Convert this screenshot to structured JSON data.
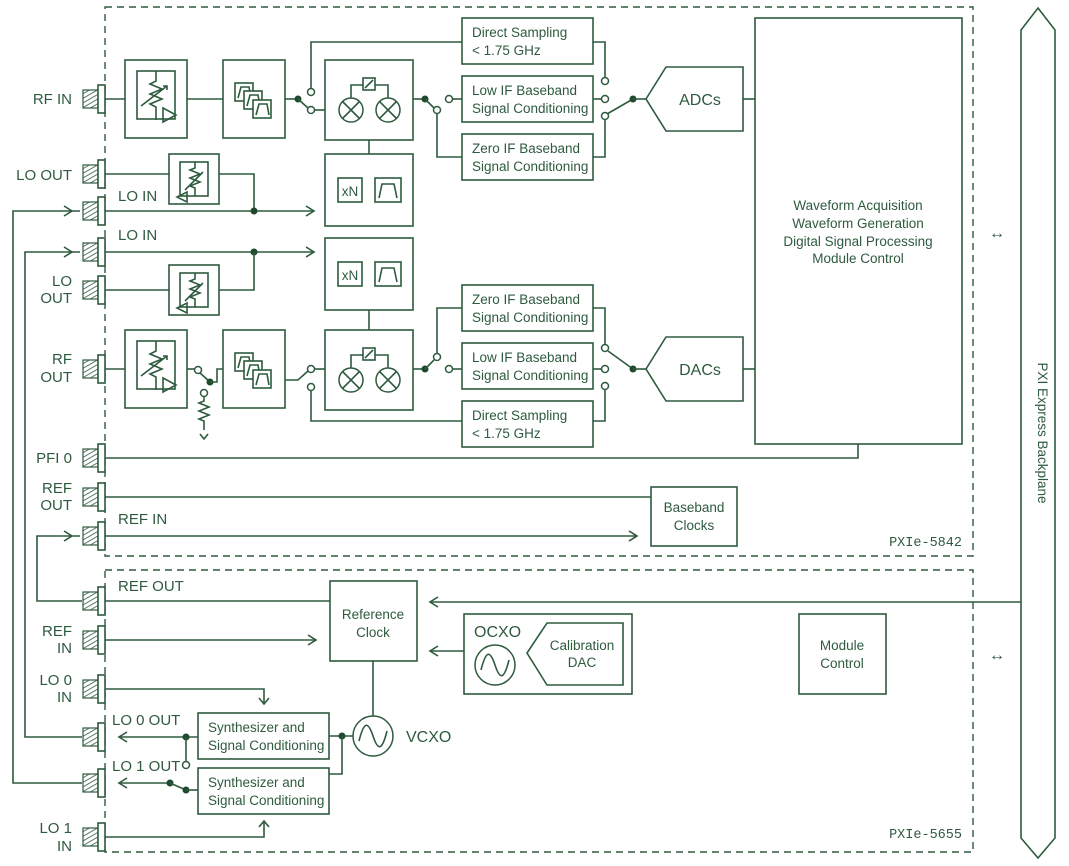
{
  "diagram": {
    "colors": {
      "line": "#2e5a3e",
      "dot": "#1f4a2e",
      "background": "#ffffff"
    },
    "backplane_label": "PXI Express Backplane",
    "modules": {
      "top": {
        "name": "PXIe-5842"
      },
      "bottom": {
        "name": "PXIe-5655"
      }
    },
    "connectors": {
      "rf_in": "RF IN",
      "lo_out_top": "LO OUT",
      "lo_in_top": "LO IN",
      "lo_in_mid": "LO IN",
      "lo_out_mid_1": "LO",
      "lo_out_mid_2": "OUT",
      "rf_out_1": "RF",
      "rf_out_2": "OUT",
      "pfi0": "PFI 0",
      "ref_out_top_1": "REF",
      "ref_out_top_2": "OUT",
      "ref_in_top": "REF IN",
      "ref_out_bottom": "REF OUT",
      "ref_in_bottom_1": "REF",
      "ref_in_bottom_2": "IN",
      "lo0_in_1": "LO 0",
      "lo0_in_2": "IN",
      "lo0_out": "LO 0 OUT",
      "lo1_out": "LO 1 OUT",
      "lo1_in_1": "LO 1",
      "lo1_in_2": "IN"
    },
    "blocks": {
      "rx_direct_1": "Direct Sampling",
      "rx_direct_2": "< 1.75 GHz",
      "rx_lowif_1": "Low IF Baseband",
      "rx_lowif_2": "Signal Conditioning",
      "rx_zeroif_1": "Zero IF Baseband",
      "rx_zeroif_2": "Signal Conditioning",
      "adcs": "ADCs",
      "dacs": "DACs",
      "fpga_1": "Waveform Acquisition",
      "fpga_2": "Waveform Generation",
      "fpga_3": "Digital Signal Processing",
      "fpga_4": "Module Control",
      "tx_zeroif_1": "Zero IF Baseband",
      "tx_zeroif_2": "Signal Conditioning",
      "tx_lowif_1": "Low IF Baseband",
      "tx_lowif_2": "Signal Conditioning",
      "tx_direct_1": "Direct Sampling",
      "tx_direct_2": "< 1.75 GHz",
      "xn": "xN",
      "bb_clk_1": "Baseband",
      "bb_clk_2": "Clocks",
      "ref_clk_1": "Reference",
      "ref_clk_2": "Clock",
      "ocxo": "OCXO",
      "cal_dac_1": "Calibration",
      "cal_dac_2": "DAC",
      "mod_ctrl_1": "Module",
      "mod_ctrl_2": "Control",
      "synth_1": "Synthesizer and",
      "synth_2": "Signal Conditioning",
      "vcxo": "VCXO"
    },
    "bus_arrow_symbol": "↔"
  }
}
